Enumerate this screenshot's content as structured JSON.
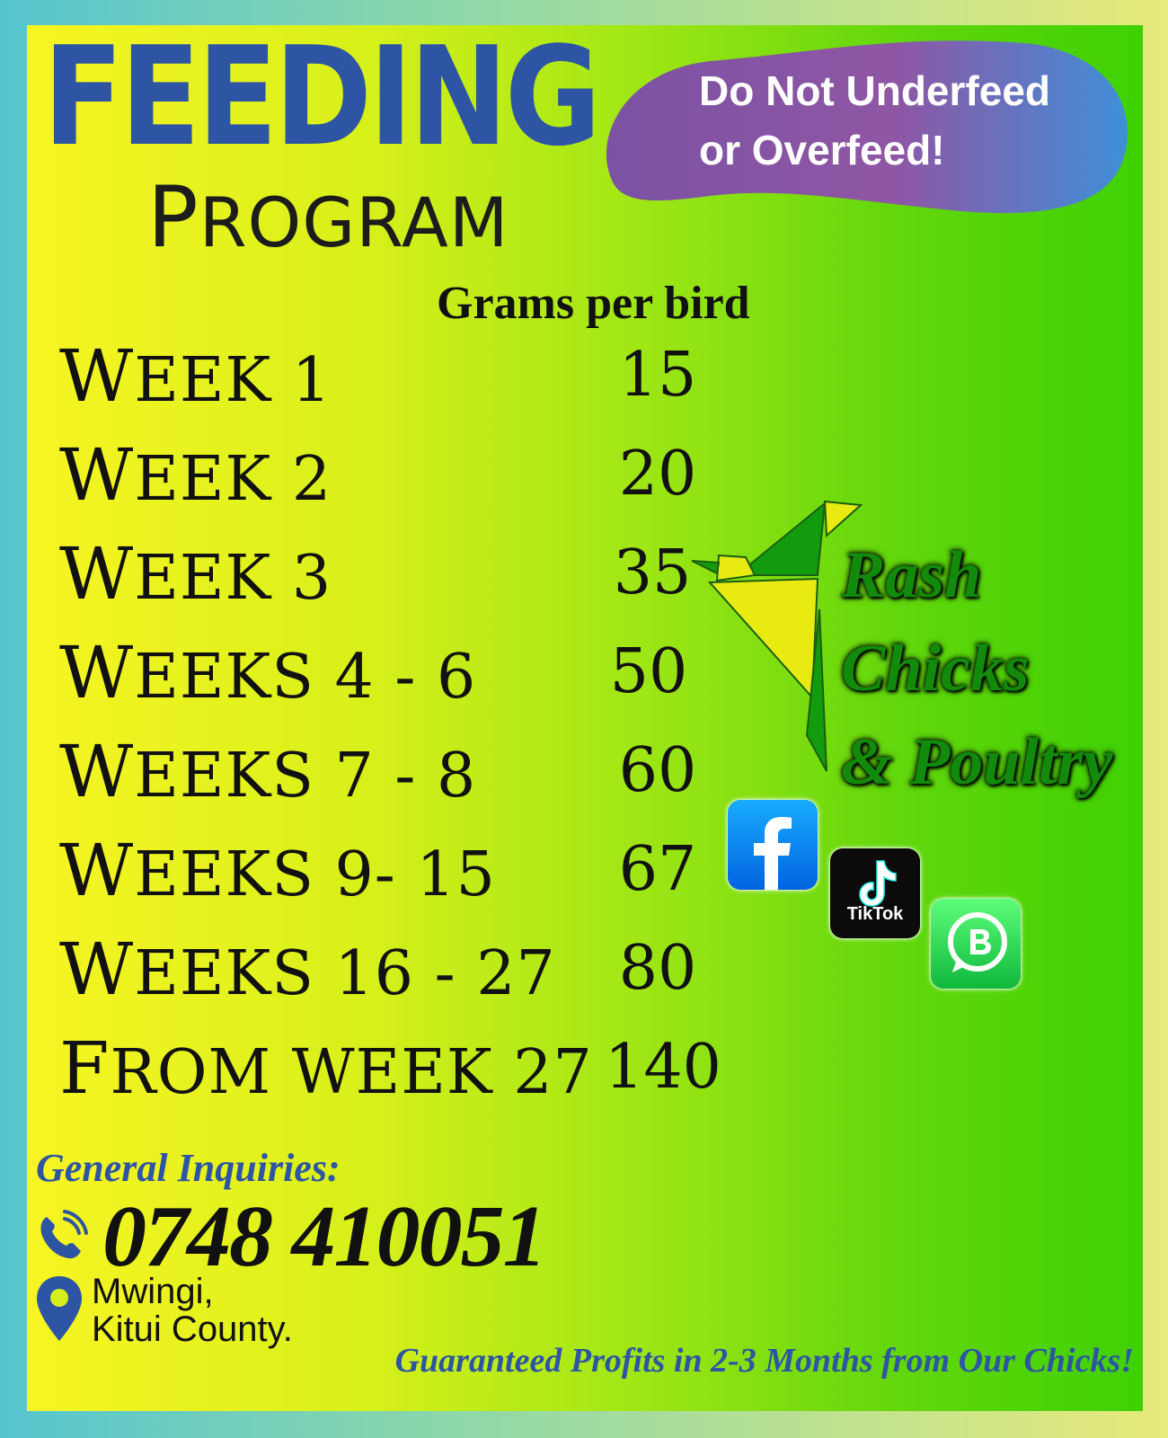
{
  "title": "FEEDING",
  "subtitle": {
    "first": "P",
    "rest": "ROGRAM"
  },
  "callout": {
    "line1": "Do Not Underfeed",
    "line2": "or Overfeed!"
  },
  "column_header": "Grams per bird",
  "rows": [
    {
      "cap": "W",
      "rest": "EEK 1",
      "value": "15"
    },
    {
      "cap": "W",
      "rest": "EEK 2",
      "value": "20"
    },
    {
      "cap": "W",
      "rest": "EEK 3",
      "value": "35"
    },
    {
      "cap": "W",
      "rest": "EEKS 4 - 6",
      "value": "50"
    },
    {
      "cap": "W",
      "rest": "EEKS 7 - 8",
      "value": "60"
    },
    {
      "cap": "W",
      "rest": "EEKS 9- 15",
      "value": "67"
    },
    {
      "cap": "W",
      "rest": "EEKS 16 - 27",
      "value": "80"
    },
    {
      "cap": "F",
      "rest": "ROM WEEK 27",
      "value": "140"
    }
  ],
  "brand": {
    "line1": "Rash",
    "line2": "Chicks",
    "line3": "& Poultry"
  },
  "social": {
    "facebook_icon": "facebook-icon",
    "tiktok_label": "TikTok",
    "whatsapp_icon": "whatsapp-business-icon"
  },
  "contact": {
    "inquiries_label": "General Inquiries:",
    "phone": "0748 410051",
    "address_line1": "Mwingi,",
    "address_line2": "Kitui County."
  },
  "tagline": "Guaranteed Profits in 2-3 Months from Our Chicks!",
  "colors": {
    "title_blue": "#2d55a3",
    "brand_green": "#128a0b",
    "blob_purple": "#7e5aa3"
  }
}
